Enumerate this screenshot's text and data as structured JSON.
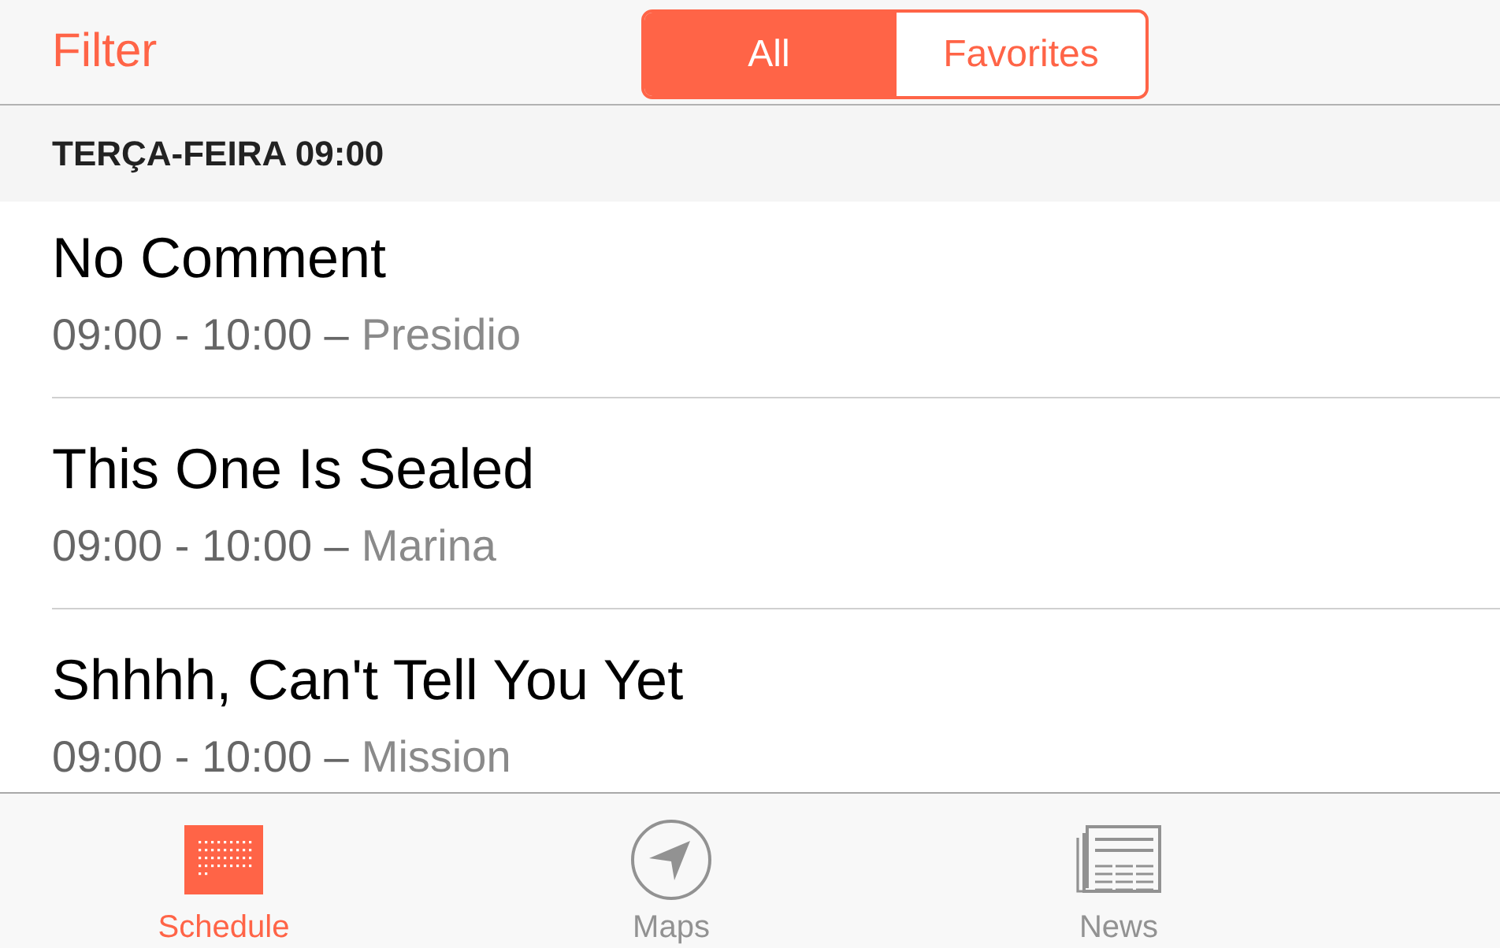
{
  "nav": {
    "filter_label": "Filter",
    "segments": [
      {
        "label": "All",
        "selected": true
      },
      {
        "label": "Favorites",
        "selected": false
      }
    ]
  },
  "section": {
    "title": "TERÇA-FEIRA 09:00"
  },
  "sessions": [
    {
      "title": "No Comment",
      "time": "09:00 - 10:00 –",
      "location": "Presidio"
    },
    {
      "title": "This One Is Sealed",
      "time": "09:00 - 10:00 –",
      "location": "Marina"
    },
    {
      "title": "Shhhh, Can't Tell You Yet",
      "time": "09:00 - 10:00 –",
      "location": "Mission"
    }
  ],
  "tab_bar": {
    "tabs": [
      {
        "label": "Schedule",
        "selected": true
      },
      {
        "label": "Maps",
        "selected": false
      },
      {
        "label": "News",
        "selected": false
      }
    ]
  }
}
